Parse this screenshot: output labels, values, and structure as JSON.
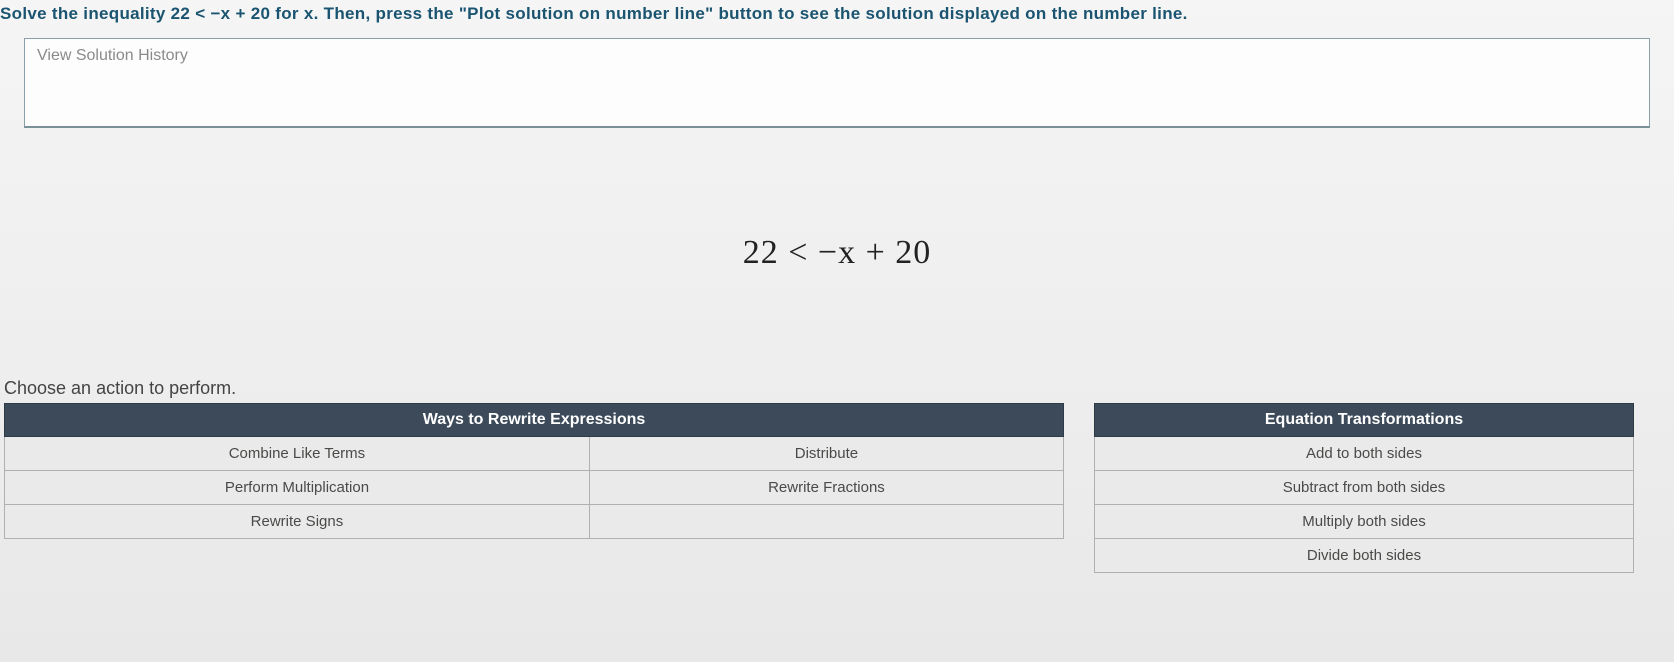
{
  "instruction": {
    "pre": "Solve the inequality ",
    "expr": "22 < −x + 20",
    "mid": " for ",
    "var": "x",
    "post": ". Then, press the \"Plot solution on number line\" button to see the solution displayed on the number line."
  },
  "history_label": "View Solution History",
  "equation": "22 < −x + 20",
  "action_prompt": "Choose an action to perform.",
  "rewrite": {
    "header": "Ways to Rewrite Expressions",
    "cells": {
      "r1c1": "Combine Like Terms",
      "r1c2": "Distribute",
      "r2c1": "Perform Multiplication",
      "r2c2": "Rewrite Fractions",
      "r3c1": "Rewrite Signs",
      "r3c2": ""
    }
  },
  "transform": {
    "header": "Equation Transformations",
    "cells": {
      "r1": "Add to both sides",
      "r2": "Subtract from both sides",
      "r3": "Multiply both sides",
      "r4": "Divide both sides"
    }
  }
}
